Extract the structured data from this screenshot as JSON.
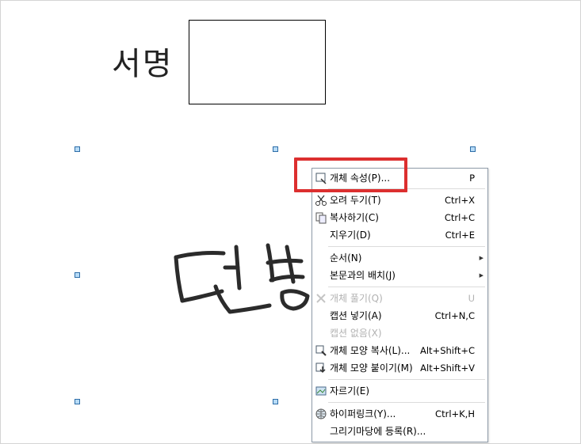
{
  "document": {
    "signature_label": "서명"
  },
  "context_menu": {
    "items": [
      {
        "label": "개체 속성(P)...",
        "shortcut": "P",
        "icon": "object-properties-icon",
        "disabled": false
      },
      {
        "label": "오려 두기(T)",
        "shortcut": "Ctrl+X",
        "icon": "scissors-icon",
        "disabled": false
      },
      {
        "label": "복사하기(C)",
        "shortcut": "Ctrl+C",
        "icon": "copy-icon",
        "disabled": false
      },
      {
        "label": "지우기(D)",
        "shortcut": "Ctrl+E",
        "icon": "",
        "disabled": false
      },
      {
        "label": "순서(N)",
        "shortcut": "",
        "icon": "",
        "disabled": false,
        "submenu": true
      },
      {
        "label": "본문과의 배치(J)",
        "shortcut": "",
        "icon": "",
        "disabled": false,
        "submenu": true
      },
      {
        "label": "개체 풀기(Q)",
        "shortcut": "U",
        "icon": "ungroup-icon",
        "disabled": true
      },
      {
        "label": "캡션 넣기(A)",
        "shortcut": "Ctrl+N,C",
        "icon": "",
        "disabled": false
      },
      {
        "label": "캡션 없음(X)",
        "shortcut": "",
        "icon": "",
        "disabled": true
      },
      {
        "label": "개체 모양 복사(L)...",
        "shortcut": "Alt+Shift+C",
        "icon": "copy-shape-icon",
        "disabled": false
      },
      {
        "label": "개체 모양 붙이기(M)",
        "shortcut": "Alt+Shift+V",
        "icon": "paste-shape-icon",
        "disabled": false
      },
      {
        "label": "자르기(E)",
        "shortcut": "",
        "icon": "crop-icon",
        "disabled": false
      },
      {
        "label": "하이퍼링크(Y)...",
        "shortcut": "Ctrl+K,H",
        "icon": "hyperlink-globe-icon",
        "disabled": false
      },
      {
        "label": "그리기마당에 등록(R)...",
        "shortcut": "",
        "icon": "",
        "disabled": false
      }
    ]
  },
  "colors": {
    "highlight": "#dc2f2f",
    "handle_fill": "#b8dcf7",
    "handle_border": "#2e6ea8"
  }
}
